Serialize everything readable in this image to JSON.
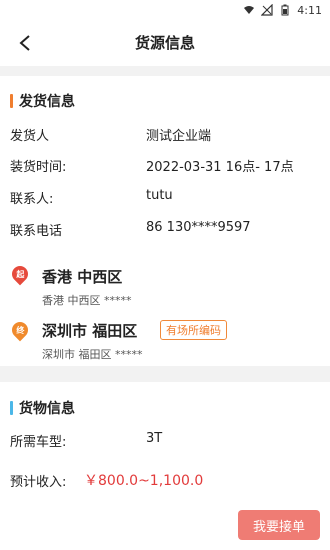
{
  "status_bar": {
    "time": "4:11"
  },
  "header": {
    "title": "货源信息"
  },
  "shipping": {
    "section_title": "发货信息",
    "shipper_label": "发货人",
    "shipper_value": "测试企业端",
    "load_time_label": "装货时间:",
    "load_time_value": "2022-03-31 16点- 17点",
    "contact_label": "联系人:",
    "contact_value": "tutu",
    "phone_label": "联系电话",
    "phone_value": "86 130****9597"
  },
  "route": {
    "origin_badge": "起",
    "origin_title": "香港 中西区",
    "origin_sub": "香港 中西区 *****",
    "dest_badge": "终",
    "dest_title": "深圳市 福田区",
    "dest_sub": "深圳市 福田区 *****",
    "dest_code_badge": "有场所编码"
  },
  "cargo": {
    "section_title": "货物信息",
    "vehicle_label": "所需车型:",
    "vehicle_value": "3T"
  },
  "income": {
    "label": "预计收入:",
    "value": "￥800.0~1,100.0"
  },
  "actions": {
    "accept_label": "我要接单"
  },
  "colors": {
    "accent": "#f07e2f",
    "price": "#e23b3b",
    "button": "#ef7c74",
    "blue_bar": "#4bb7e8"
  }
}
